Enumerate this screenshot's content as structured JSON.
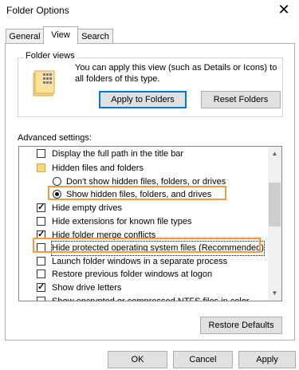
{
  "window": {
    "title": "Folder Options"
  },
  "tabs": [
    {
      "label": "General"
    },
    {
      "label": "View"
    },
    {
      "label": "Search"
    }
  ],
  "folder_views": {
    "legend": "Folder views",
    "description_line1": "You can apply this view (such as Details or Icons) to",
    "description_line2": "all folders of this type.",
    "apply_label": "Apply to Folders",
    "reset_label": "Reset Folders"
  },
  "advanced": {
    "label": "Advanced settings:",
    "items": [
      {
        "type": "checkbox",
        "label": "Display the full path in the title bar",
        "checked": false
      },
      {
        "type": "folder",
        "label": "Hidden files and folders"
      },
      {
        "type": "radio",
        "label": "Don't show hidden files, folders, or drives",
        "checked": false
      },
      {
        "type": "radio",
        "label": "Show hidden files, folders, and drives",
        "checked": true
      },
      {
        "type": "checkbox",
        "label": "Hide empty drives",
        "checked": true
      },
      {
        "type": "checkbox",
        "label": "Hide extensions for known file types",
        "checked": false
      },
      {
        "type": "checkbox",
        "label": "Hide folder merge conflicts",
        "checked": true
      },
      {
        "type": "checkbox",
        "label": "Hide protected operating system files (Recommended)",
        "checked": false
      },
      {
        "type": "checkbox",
        "label": "Launch folder windows in a separate process",
        "checked": false
      },
      {
        "type": "checkbox",
        "label": "Restore previous folder windows at logon",
        "checked": false
      },
      {
        "type": "checkbox",
        "label": "Show drive letters",
        "checked": true
      },
      {
        "type": "checkbox",
        "label": "Show encrypted or compressed NTFS files in color",
        "checked": false
      }
    ],
    "restore_label": "Restore Defaults"
  },
  "footer": {
    "ok_label": "OK",
    "cancel_label": "Cancel",
    "apply_label": "Apply"
  },
  "colors": {
    "highlight": "#f39c3d",
    "focus_button": "#0078d7"
  }
}
